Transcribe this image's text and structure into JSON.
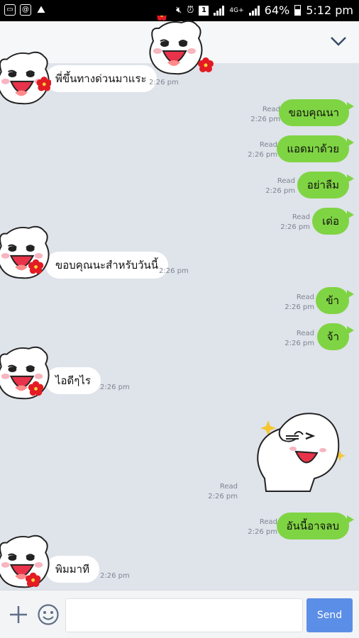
{
  "status_bar": {
    "battery": "64%",
    "time": "5:12 pm",
    "network": "4G+",
    "sim": "1"
  },
  "chat": {
    "messages": [
      {
        "dir": "in",
        "text": "พี่ขึ้นทางด่วนมาแระ",
        "time": "2:26 pm"
      },
      {
        "dir": "out",
        "text": "ขอบคุณนา",
        "read": "Read",
        "time": "2:26 pm"
      },
      {
        "dir": "out",
        "text": "แอดมาด้วย",
        "read": "Read",
        "time": "2:26 pm"
      },
      {
        "dir": "out",
        "text": "อย่าลืม",
        "read": "Read",
        "time": "2:26 pm"
      },
      {
        "dir": "out",
        "text": "เด่อ",
        "read": "Read",
        "time": "2:26 pm"
      },
      {
        "dir": "in",
        "text": "ขอบคุณนะสำหรับวันนี้",
        "time": "2:26 pm"
      },
      {
        "dir": "out",
        "text": "ข้า",
        "read": "Read",
        "time": "2:26 pm"
      },
      {
        "dir": "out",
        "text": "จ้า",
        "read": "Read",
        "time": "2:26 pm"
      },
      {
        "dir": "in",
        "text": "ไอดีๆไร",
        "time": "2:26 pm"
      },
      {
        "dir": "out",
        "sticker": "wink-sticker",
        "read": "Read",
        "time": "2:26 pm"
      },
      {
        "dir": "out",
        "text": "อันนี้อาจลบ",
        "read": "Read",
        "time": "2:26 pm"
      },
      {
        "dir": "in",
        "text": "พิมมาที",
        "time": "2:26 pm"
      }
    ]
  },
  "input": {
    "placeholder": "",
    "send_label": "Send"
  },
  "colors": {
    "out_bubble": "#7fd443",
    "in_bubble": "#ffffff",
    "background": "#dfe3ea",
    "send_button": "#5b8ee6"
  }
}
